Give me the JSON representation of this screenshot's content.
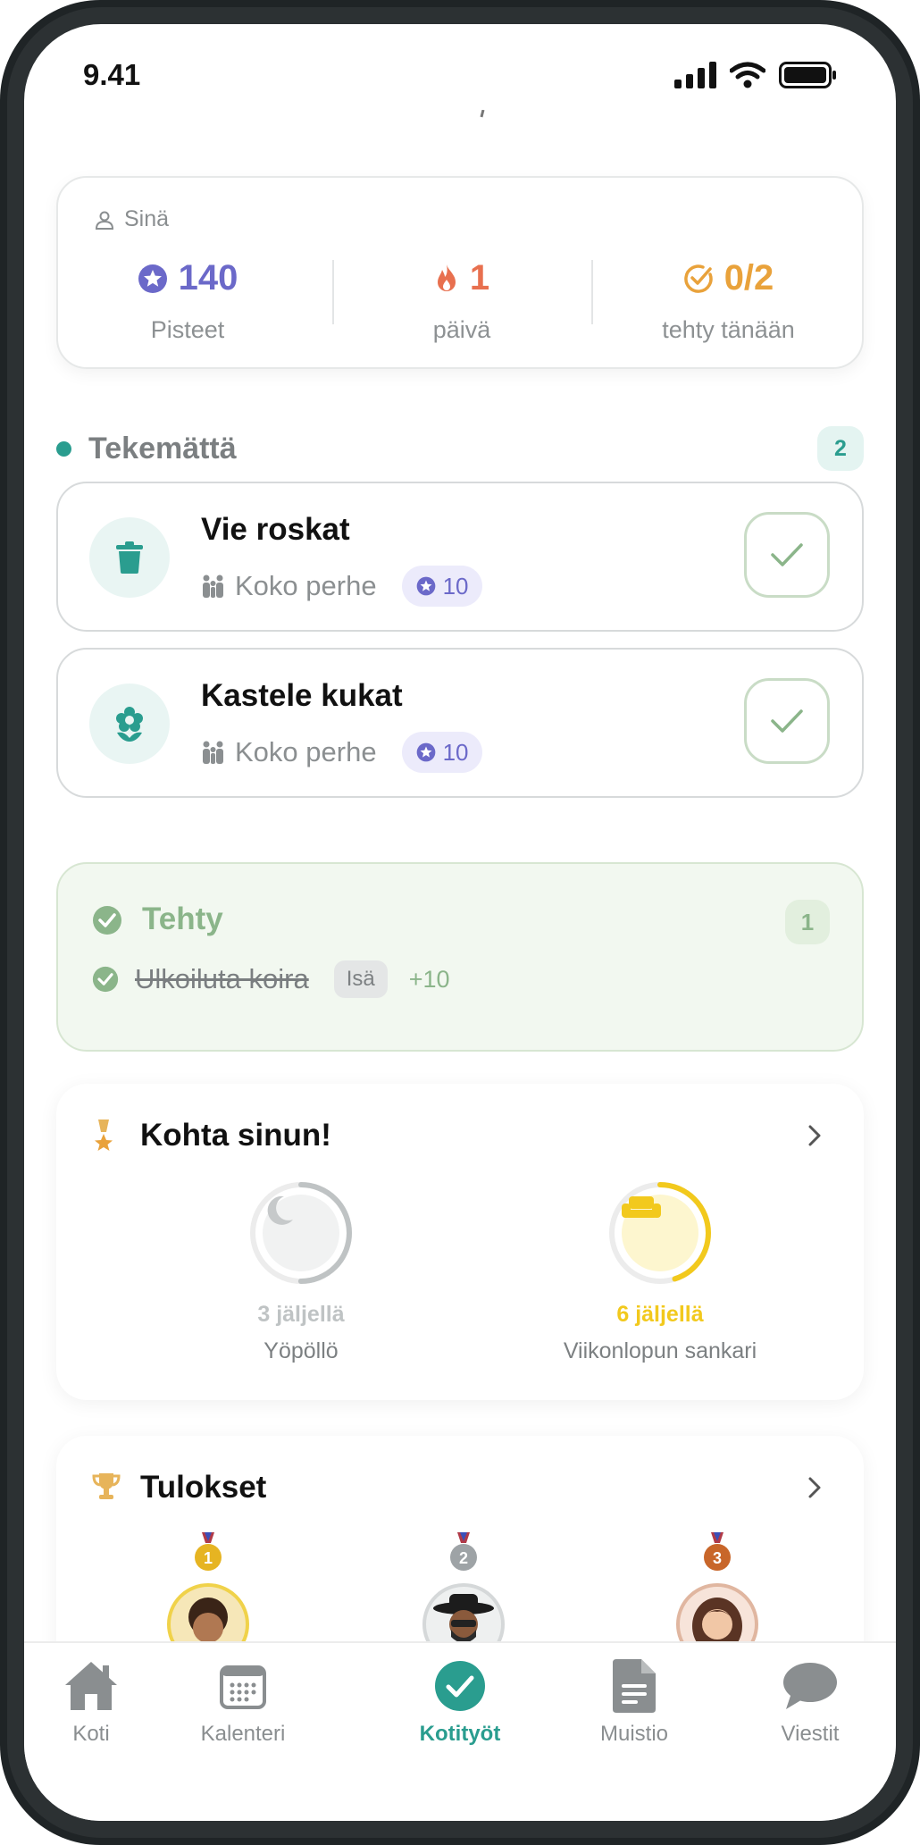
{
  "status_bar": {
    "time": "9.41",
    "icons": [
      "signal-icon",
      "wifi-icon",
      "battery-icon"
    ]
  },
  "profile": {
    "label": "Sinä",
    "points": {
      "value": "140",
      "label": "Pisteet"
    },
    "streak": {
      "value": "1",
      "label": "päivä"
    },
    "today": {
      "value": "0/2",
      "label": "tehty tänään"
    }
  },
  "todo": {
    "title": "Tekemättä",
    "count": "2",
    "items": [
      {
        "title": "Vie roskat",
        "assignee": "Koko perhe",
        "points": "10",
        "icon": "trash-icon"
      },
      {
        "title": "Kastele kukat",
        "assignee": "Koko perhe",
        "points": "10",
        "icon": "flower-icon"
      }
    ]
  },
  "done": {
    "title": "Tehty",
    "count": "1",
    "items": [
      {
        "title": "Ulkoiluta koira",
        "who": "Isä",
        "points": "+10"
      }
    ]
  },
  "achievements": {
    "title": "Kohta sinun!",
    "items": [
      {
        "remaining": "3 jäljellä",
        "name": "Yöpöllö",
        "icon": "moon-icon",
        "progress": 0.5,
        "color": "#bfc3c4"
      },
      {
        "remaining": "6 jäljellä",
        "name": "Viikonlopun sankari",
        "icon": "sofa-icon",
        "progress": 0.45,
        "color": "#f2c91d"
      }
    ]
  },
  "results": {
    "title": "Tulokset",
    "ranks": [
      {
        "rank": "1",
        "color": "#e6b422"
      },
      {
        "rank": "2",
        "color": "#9ea3a6"
      },
      {
        "rank": "3",
        "color": "#c8662a"
      }
    ]
  },
  "tabs": [
    {
      "label": "Koti",
      "icon": "home-icon"
    },
    {
      "label": "Kalenteri",
      "icon": "calendar-icon"
    },
    {
      "label": "Kotityöt",
      "icon": "check-circle-icon",
      "active": true
    },
    {
      "label": "Muistio",
      "icon": "note-icon"
    },
    {
      "label": "Viestit",
      "icon": "chat-icon"
    }
  ],
  "colors": {
    "accent": "#2a9d8f",
    "points": "#6b69c9",
    "streak": "#e8704f",
    "today": "#e9a23b",
    "done": "#8bb58a"
  }
}
